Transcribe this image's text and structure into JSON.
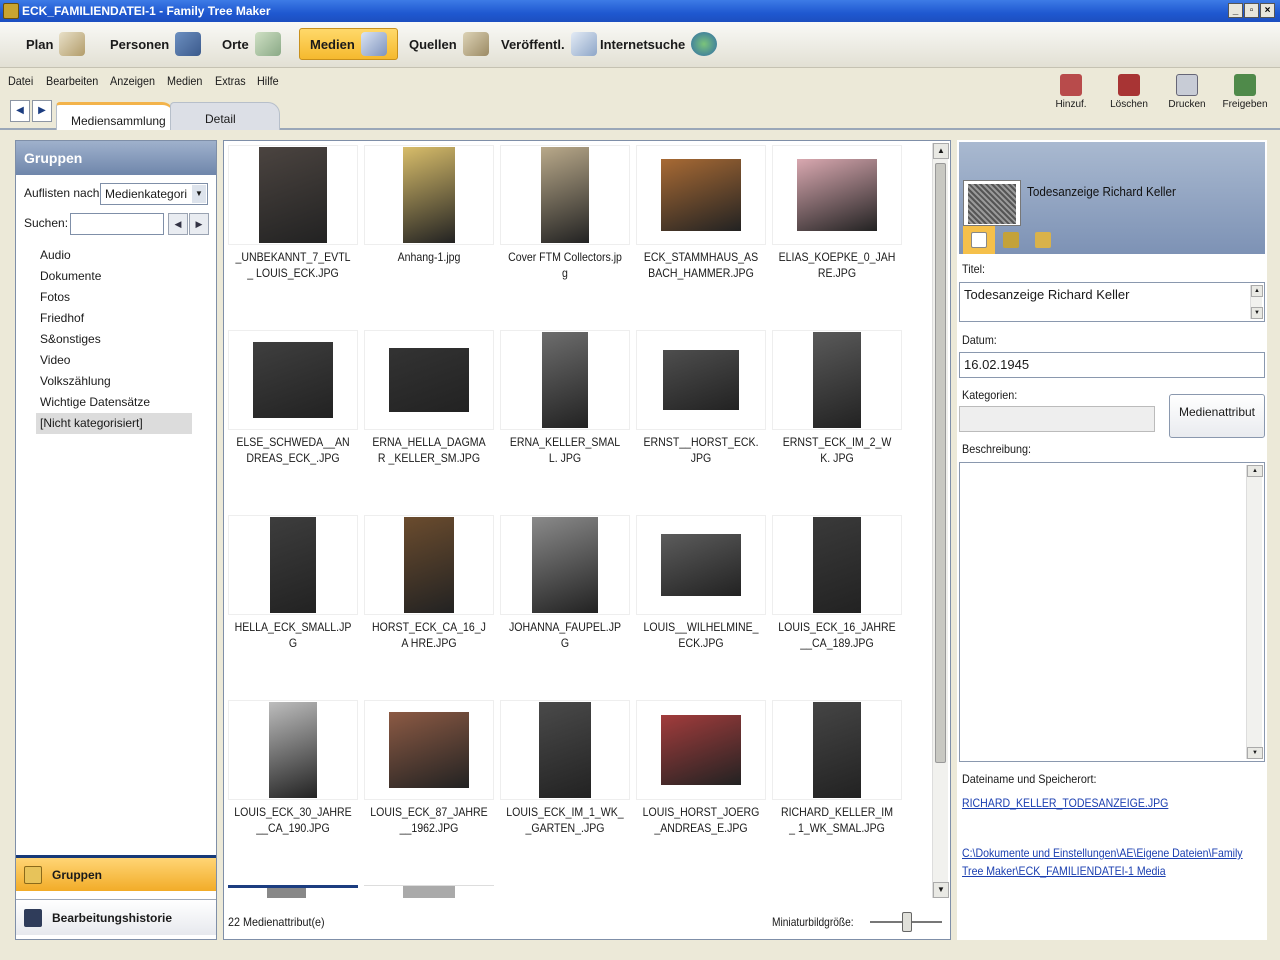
{
  "window": {
    "title": "ECK_FAMILIENDATEI-1 - Family Tree Maker",
    "minimize": "_",
    "maximize": "▫",
    "close": "×"
  },
  "toolbar": {
    "plan": "Plan",
    "personen": "Personen",
    "orte": "Orte",
    "medien": "Medien",
    "quellen": "Quellen",
    "veroeffentl": "Veröffentl.",
    "internetsuche": "Internetsuche"
  },
  "menu": [
    "Datei",
    "Bearbeiten",
    "Anzeigen",
    "Medien",
    "Extras",
    "Hilfe"
  ],
  "right_tools": {
    "hinzuf": "Hinzuf.",
    "loeschen": "Löschen",
    "drucken": "Drucken",
    "freigeben": "Freigeben"
  },
  "tabs": {
    "prev": "◀",
    "next": "▶",
    "mediensammlung": "Mediensammlung",
    "detail": "Detail"
  },
  "left_panel": {
    "header": "Gruppen",
    "list_by_label": "Auflisten nach:",
    "list_by_value": "Medienkategori",
    "search_label": "Suchen:",
    "search_value": "",
    "search_prev": "◀",
    "search_next": "▶",
    "categories": [
      "Audio",
      "Dokumente",
      "Fotos",
      "Friedhof",
      "S&onstiges",
      "Video",
      "Volkszählung",
      "Wichtige Datensätze",
      "[Nicht kategorisiert]"
    ],
    "btn_gruppen": "Gruppen",
    "btn_historie": "Bearbeitungshistorie"
  },
  "media": [
    {
      "label": "_UNBEKANNT_7_EVTL_ LOUIS_ECK.JPG",
      "color": "#4b4440"
    },
    {
      "label": "Anhang-1.jpg",
      "color": "#d8bd6a"
    },
    {
      "label": "Cover FTM Collectors.jpg",
      "color": "#b9a98a"
    },
    {
      "label": "ECK_STAMMHAUS_AS BACH_HAMMER.JPG",
      "color": "#a86a34"
    },
    {
      "label": "ELIAS_KOEPKE_0_JAH RE.JPG",
      "color": "#d9a8b0"
    },
    {
      "label": "ELSE_SCHWEDA__AN DREAS_ECK_.JPG",
      "color": "#3f3f3f"
    },
    {
      "label": "ERNA_HELLA_DAGMAR _KELLER_SM.JPG",
      "color": "#333333"
    },
    {
      "label": "ERNA_KELLER_SMALL. JPG",
      "color": "#6d6d6d"
    },
    {
      "label": "ERNST__HORST_ECK. JPG",
      "color": "#4e4e4e"
    },
    {
      "label": "ERNST_ECK_IM_2_WK. JPG",
      "color": "#5a5a5a"
    },
    {
      "label": "HELLA_ECK_SMALL.JP G",
      "color": "#3d3d3d"
    },
    {
      "label": "HORST_ECK_CA_16_JA HRE.JPG",
      "color": "#6b4c2e"
    },
    {
      "label": "JOHANNA_FAUPEL.JPG",
      "color": "#8a8a8a"
    },
    {
      "label": "LOUIS__WILHELMINE_ ECK.JPG",
      "color": "#5c5c5c"
    },
    {
      "label": "LOUIS_ECK_16_JAHRE __CA_189.JPG",
      "color": "#3a3a3a"
    },
    {
      "label": "LOUIS_ECK_30_JAHRE __CA_190.JPG",
      "color": "#bdbdbd"
    },
    {
      "label": "LOUIS_ECK_87_JAHRE __1962.JPG",
      "color": "#8c5a44"
    },
    {
      "label": "LOUIS_ECK_IM_1_WK_ _GARTEN_.JPG",
      "color": "#4a4a4a"
    },
    {
      "label": "LOUIS_HORST_JOERG _ANDREAS_E.JPG",
      "color": "#a23c3c"
    },
    {
      "label": "RICHARD_KELLER_IM_ 1_WK_SMAL.JPG",
      "color": "#454545"
    }
  ],
  "center_footer": {
    "count": "22 Medienattribut(e)",
    "zoom_label": "Miniaturbildgröße:"
  },
  "detail": {
    "header_title": "Todesanzeige Richard Keller",
    "title_label": "Titel:",
    "title_value": "Todesanzeige Richard Keller",
    "date_label": "Datum:",
    "date_value": "16.02.1945",
    "categories_label": "Kategorien:",
    "attr_button": "Medienattribut",
    "description_label": "Beschreibung:",
    "file_label": "Dateiname und Speicherort:",
    "file_name": "RICHARD_KELLER_TODESANZEIGE.JPG",
    "file_path": "C:\\Dokumente und Einstellungen\\AE\\Eigene Dateien\\Family Tree Maker\\ECK_FAMILIENDATEI-1 Media"
  }
}
